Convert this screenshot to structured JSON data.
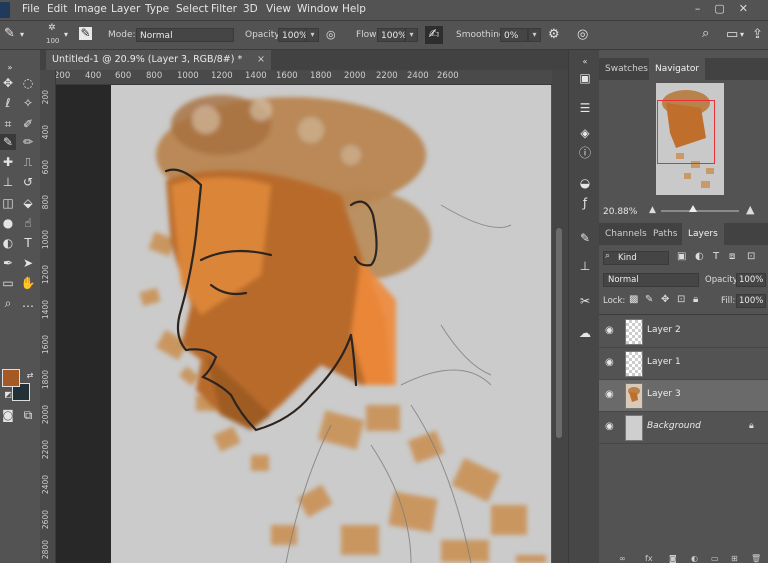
{
  "menubar": {
    "items": [
      "File",
      "Edit",
      "Image",
      "Layer",
      "Type",
      "Select",
      "Filter",
      "3D",
      "View",
      "Window",
      "Help"
    ]
  },
  "options": {
    "brush_size": "100",
    "mode_label": "Mode:",
    "mode_value": "Normal",
    "opacity_label": "Opacity:",
    "opacity_value": "100%",
    "flow_label": "Flow:",
    "flow_value": "100%",
    "smoothing_label": "Smoothing:",
    "smoothing_value": "0%"
  },
  "document": {
    "tab_title": "Untitled-1 @ 20.9% (Layer 3, RGB/8#) *",
    "close": "×"
  },
  "ruler_top": [
    "200",
    "400",
    "600",
    "800",
    "1000",
    "1200",
    "1400",
    "1600",
    "1800",
    "2000",
    "2200",
    "2400",
    "2600"
  ],
  "ruler_left": [
    "200",
    "400",
    "600",
    "800",
    "1000",
    "1200",
    "1400",
    "1600",
    "1800",
    "2000",
    "2200",
    "2400",
    "2600",
    "2800"
  ],
  "navigator": {
    "tabs": [
      "Swatches",
      "Navigator"
    ],
    "zoom": "20.88%"
  },
  "layers_panel": {
    "tabs": [
      "Channels",
      "Paths",
      "Layers"
    ],
    "filter_kind": "Kind",
    "blend_mode": "Normal",
    "opacity_label": "Opacity:",
    "opacity_value": "100%",
    "lock_label": "Lock:",
    "fill_label": "Fill:",
    "fill_value": "100%",
    "layers": [
      {
        "name": "Layer 2",
        "selected": false
      },
      {
        "name": "Layer 1",
        "selected": false
      },
      {
        "name": "Layer 3",
        "selected": true
      },
      {
        "name": "Background",
        "selected": false
      }
    ]
  },
  "colors": {
    "foreground": "#a55a25",
    "background": "#233136",
    "skin": "#c8702a",
    "selection_rect": "#e8303a"
  }
}
